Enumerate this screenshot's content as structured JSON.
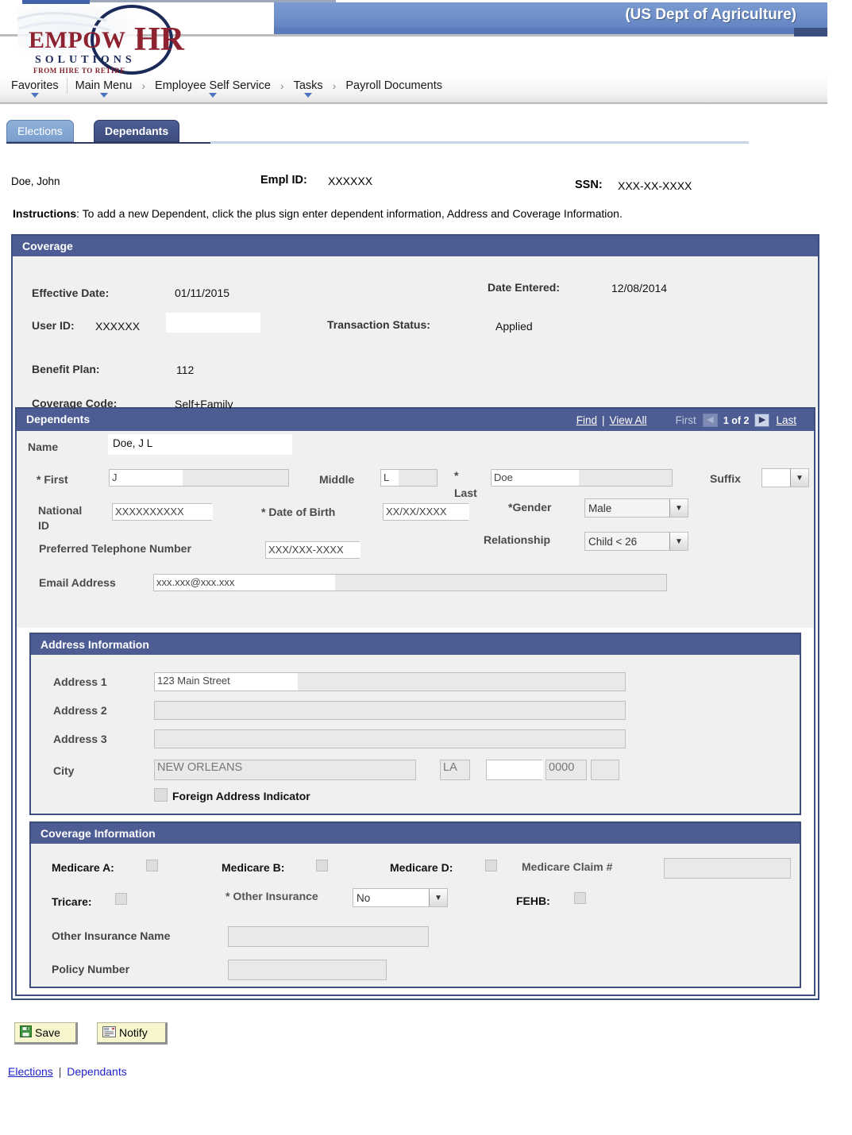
{
  "banner": {
    "agency_title": "(US Dept of Agriculture)",
    "logo": {
      "word_empow": "EMPOW",
      "word_hr": "HR",
      "word_solutions": "SOLUTIONS",
      "tagline": "FROM HIRE TO RETIRE"
    }
  },
  "breadcrumb": {
    "items": [
      {
        "label": "Favorites",
        "has_menu": true
      },
      {
        "label": "Main Menu",
        "has_menu": true
      },
      {
        "label": "Employee Self Service",
        "has_menu": true
      },
      {
        "label": "Tasks",
        "has_menu": true
      },
      {
        "label": "Payroll Documents",
        "has_menu": false
      }
    ],
    "separator": "›"
  },
  "tabs": [
    {
      "label": "Elections",
      "active": false
    },
    {
      "label": "Dependants",
      "active": true
    }
  ],
  "employee": {
    "name": "Doe, John",
    "empl_id_label": "Empl ID:",
    "empl_id_value": "XXXXXX",
    "ssn_label": "SSN:",
    "ssn_value": "XXX-XX-XXXX"
  },
  "instructions": {
    "label": "Instructions",
    "text": ":  To add a new Dependent, click the plus sign enter dependent information, Address and Coverage Information."
  },
  "coverage": {
    "section_title": "Coverage",
    "effective_date_label": "Effective Date:",
    "effective_date_value": "01/11/2015",
    "date_entered_label": "Date Entered:",
    "date_entered_value": "12/08/2014",
    "user_id_label": "User ID:",
    "user_id_value": "XXXXXX",
    "transaction_status_label": "Transaction Status:",
    "transaction_status_value": "Applied",
    "benefit_plan_label": "Benefit Plan:",
    "benefit_plan_value": "112",
    "coverage_code_label": "Coverage Code:",
    "coverage_code_value": "Self+Family"
  },
  "dependents": {
    "section_title": "Dependents",
    "find_label": "Find",
    "pipe": "|",
    "view_all_label": "View All",
    "first_label": "First",
    "counter": "1 of 2",
    "last_label": "Last",
    "prev_icon": "◀",
    "next_icon": "▶",
    "name_label": "Name",
    "name_value": "Doe, J L",
    "first_label_f": "* First",
    "first_value": "J",
    "middle_label": "Middle",
    "middle_value": "L",
    "last_label_star": "*",
    "last_value": "Doe",
    "suffix_label": "Suffix",
    "suffix_value": "",
    "national_id_label_1": "National",
    "national_id_label_2": "ID",
    "national_id_value": "XXXXXXXXXX",
    "dob_label": "* Date of Birth",
    "dob_value": "XX/XX/XXXX",
    "gender_label": "*Gender",
    "gender_value": "Male",
    "phone_label": "Preferred Telephone Number",
    "phone_value": "XXX/XXX-XXXX",
    "relationship_label": "Relationship",
    "relationship_value": "Child < 26",
    "email_label": "Email Address",
    "email_value": "xxx.xxx@xxx.xxx"
  },
  "address": {
    "section_title": "Address Information",
    "address1_label": "Address 1",
    "address1_value": "123 Main Street",
    "address2_label": "Address 2",
    "address2_value": "",
    "address3_label": "Address 3",
    "address3_value": "",
    "city_label": "City",
    "city_value": "NEW ORLEANS",
    "state_value": "LA",
    "county_value": "",
    "zip_value": "0000",
    "zip_ext_value": "",
    "foreign_label": "Foreign Address Indicator",
    "foreign_checked": false
  },
  "coverage_info": {
    "section_title": "Coverage Information",
    "medicare_a_label": "Medicare A:",
    "medicare_b_label": "Medicare B:",
    "medicare_d_label": "Medicare D:",
    "medicare_claim_label": "Medicare Claim #",
    "medicare_claim_value": "",
    "tricare_label": "Tricare:",
    "other_insurance_label": "* Other Insurance",
    "other_insurance_value": "No",
    "fehb_label": "FEHB:",
    "other_insurance_name_label": "Other Insurance Name",
    "other_insurance_name_value": "",
    "policy_number_label": "Policy Number",
    "policy_number_value": ""
  },
  "actions": {
    "save_label": "Save",
    "notify_label": "Notify"
  },
  "footer": {
    "elections_link": "Elections",
    "separator": "|",
    "dependants_link": "Dependants"
  },
  "colors": {
    "header_blue": "#6f8fc9",
    "section_navy": "#4d5d93",
    "panel_border": "#3d4f7f",
    "tab_active": "#3e4c7e",
    "tab_inactive": "#7ba0ce",
    "body_grey": "#f0f0ee",
    "button_yellow": "#f7f6cd",
    "link_blue": "#2222cc"
  }
}
